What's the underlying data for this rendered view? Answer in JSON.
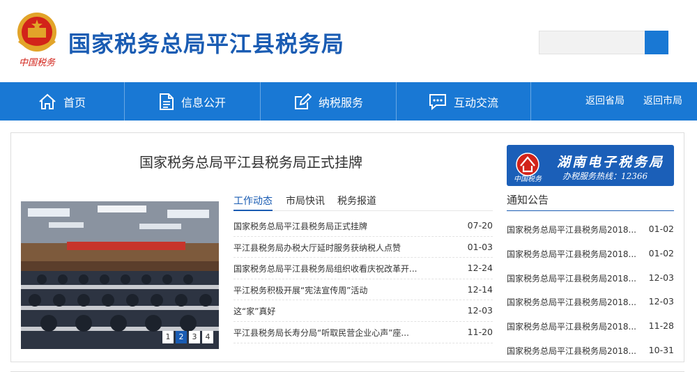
{
  "header": {
    "emblem_caption": "中国税务",
    "site_title": "国家税务总局平江县税务局",
    "search_placeholder": ""
  },
  "nav": {
    "items": [
      {
        "label": "首页",
        "icon": "home-icon"
      },
      {
        "label": "信息公开",
        "icon": "document-icon"
      },
      {
        "label": "纳税服务",
        "icon": "edit-icon"
      },
      {
        "label": "互动交流",
        "icon": "chat-icon"
      }
    ],
    "links": [
      "返回省局",
      "返回市局"
    ]
  },
  "main": {
    "headline": "国家税务总局平江县税务局正式挂牌",
    "slides": [
      "1",
      "2",
      "3",
      "4"
    ],
    "active_slide": 2,
    "tabs": [
      "工作动态",
      "市局快讯",
      "税务报道"
    ],
    "news": [
      {
        "title": "国家税务总局平江县税务局正式挂牌",
        "date": "07-20"
      },
      {
        "title": "平江县税务局办税大厅延时服务获纳税人点赞",
        "date": "01-03"
      },
      {
        "title": "国家税务总局平江县税务局组织收看庆祝改革开...",
        "date": "12-24"
      },
      {
        "title": "平江税务积极开展“宪法宣传周”活动",
        "date": "12-14"
      },
      {
        "title": "这“家”真好",
        "date": "12-03"
      },
      {
        "title": "平江县税务局长寿分局“听取民营企业心声”座...",
        "date": "11-20"
      }
    ]
  },
  "sidebar": {
    "banner": {
      "brand": "中国税务",
      "title": "湖南电子税务局",
      "hotline": "办税服务热线：12366"
    },
    "notice_heading": "通知公告",
    "notices": [
      {
        "title": "国家税务总局平江县税务局2018...",
        "date": "01-02"
      },
      {
        "title": "国家税务总局平江县税务局2018...",
        "date": "01-02"
      },
      {
        "title": "国家税务总局平江县税务局2018...",
        "date": "12-03"
      },
      {
        "title": "国家税务总局平江县税务局2018...",
        "date": "12-03"
      },
      {
        "title": "国家税务总局平江县税务局2018...",
        "date": "11-28"
      },
      {
        "title": "国家税务总局平江县税务局2018...",
        "date": "10-31"
      }
    ]
  },
  "colors": {
    "brand_blue": "#1a5cb3",
    "nav_blue": "#1978d4",
    "emblem_red": "#d2231a",
    "emblem_gold": "#e2a429"
  }
}
